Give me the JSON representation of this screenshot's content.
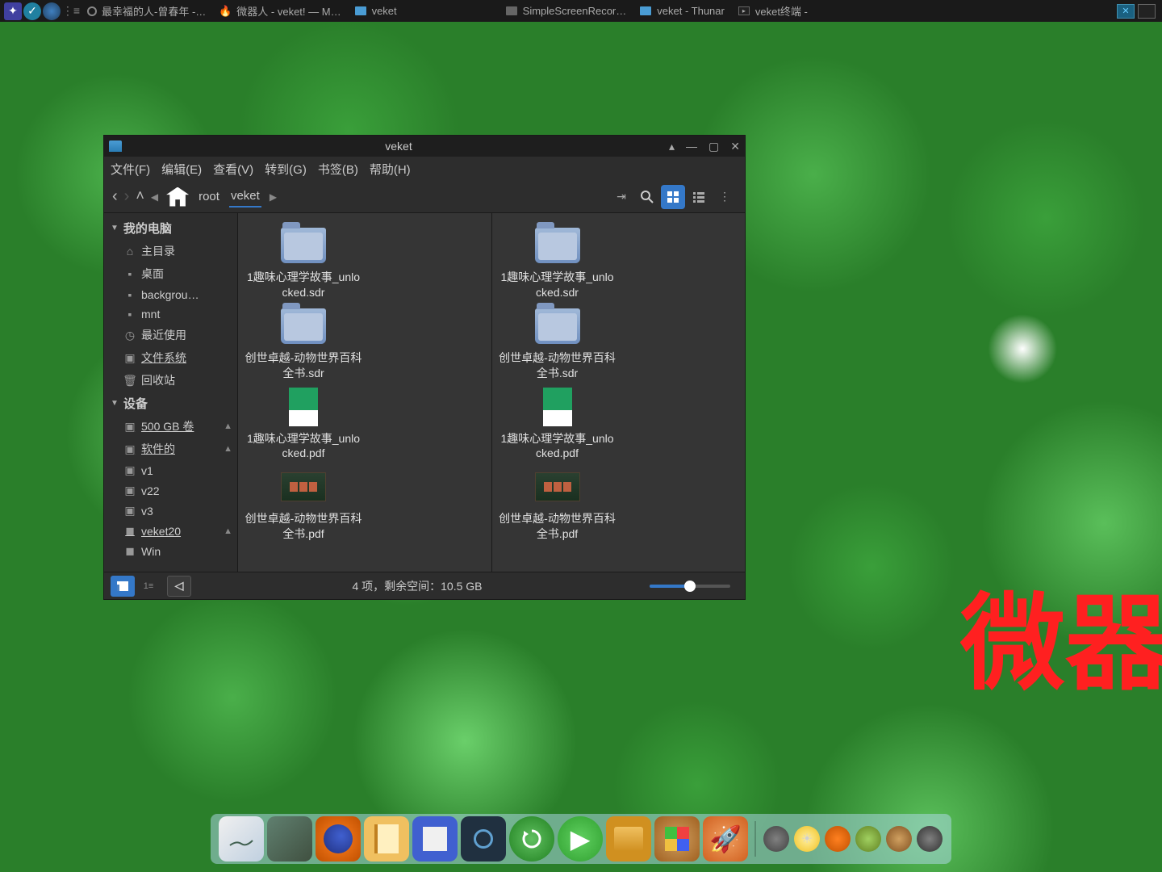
{
  "taskbar": {
    "items": [
      {
        "label": "最幸福的人-曾春年 -…",
        "icon": "audio"
      },
      {
        "label": "微器人 - veket! — M…",
        "icon": "fire"
      },
      {
        "label": "veket",
        "icon": "folder"
      },
      {
        "label": "SimpleScreenRecor…",
        "icon": "recorder"
      },
      {
        "label": "veket - Thunar",
        "icon": "folder"
      },
      {
        "label": "veket终端 -",
        "icon": "terminal"
      }
    ]
  },
  "window": {
    "title": "veket",
    "menus": [
      "文件(F)",
      "编辑(E)",
      "查看(V)",
      "转到(G)",
      "书签(B)",
      "帮助(H)"
    ],
    "breadcrumb": {
      "root": "root",
      "current": "veket"
    },
    "sidebar": {
      "section_computer": "我的电脑",
      "computer_items": [
        {
          "label": "主目录",
          "icon": "home"
        },
        {
          "label": "桌面",
          "icon": "folder"
        },
        {
          "label": "backgrou…",
          "icon": "folder"
        },
        {
          "label": "mnt",
          "icon": "folder"
        },
        {
          "label": "最近使用",
          "icon": "clock"
        },
        {
          "label": "文件系统",
          "icon": "disk",
          "selected": true
        },
        {
          "label": "回收站",
          "icon": "trash"
        }
      ],
      "section_devices": "设备",
      "device_items": [
        {
          "label": "500 GB 卷",
          "icon": "disk",
          "eject": true,
          "selected": true
        },
        {
          "label": "软件的",
          "icon": "disk",
          "eject": true,
          "selected": true
        },
        {
          "label": "v1",
          "icon": "disk"
        },
        {
          "label": "v22",
          "icon": "disk"
        },
        {
          "label": "v3",
          "icon": "disk"
        },
        {
          "label": "veket20",
          "icon": "sd",
          "eject": true,
          "selected": true
        },
        {
          "label": "Win",
          "icon": "sd"
        }
      ]
    },
    "files": [
      {
        "name": "1趣味心理学故事_unlocked.sdr",
        "type": "folder"
      },
      {
        "name": "创世卓越-动物世界百科全书.sdr",
        "type": "folder"
      },
      {
        "name": "1趣味心理学故事_unlocked.pdf",
        "type": "pdf-green"
      },
      {
        "name": "创世卓越-动物世界百科全书.pdf",
        "type": "pdf-book"
      }
    ],
    "statusbar": "4 项，剩余空间：10.5 GB"
  },
  "watermark": "微器",
  "dock": {
    "items": [
      "desktop",
      "dark-app",
      "firefox",
      "notepad",
      "paint",
      "dark-tools",
      "reload",
      "play",
      "folder",
      "spreadsheet",
      "rocket"
    ]
  }
}
